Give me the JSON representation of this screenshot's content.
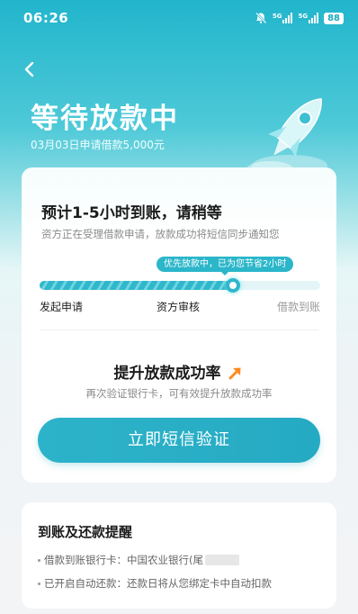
{
  "status_bar": {
    "time": "06:26",
    "signal_1_tag": "5G",
    "signal_2_tag": "5G",
    "battery": "88"
  },
  "header": {
    "title": "等待放款中",
    "subtitle": "03月03日申请借款5,000元"
  },
  "status_card": {
    "eta_title": "预计1-5小时到账，请稍等",
    "eta_desc": "资方正在受理借款申请，放款成功将短信同步通知您",
    "priority_tip": "优先放款中，已为您节省2小时",
    "progress": 0.69,
    "steps": [
      "发起申请",
      "资方审核",
      "借款到账"
    ]
  },
  "boost": {
    "title": "提升放款成功率",
    "desc": "再次验证银行卡，可有效提升放款成功率",
    "cta_label": "立即短信验证"
  },
  "reminder": {
    "title": "到账及还款提醒",
    "items": [
      "借款到账银行卡：中国农业银行(尾",
      "已开启自动还款：还款日将从您绑定卡中自动扣款"
    ]
  },
  "colors": {
    "brand": "#2bb6ca",
    "accent_arrow": "#ff8a1f"
  }
}
